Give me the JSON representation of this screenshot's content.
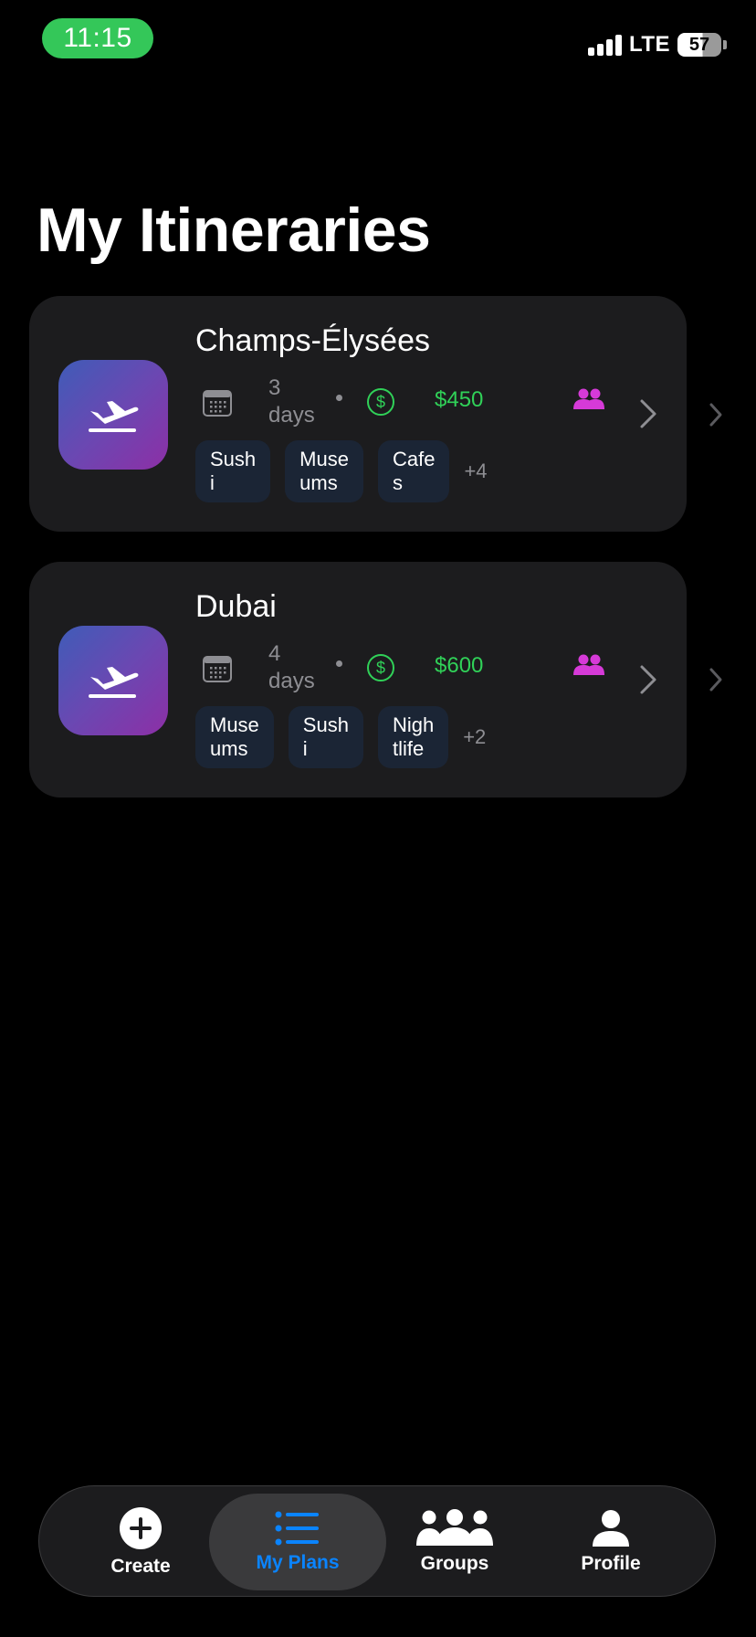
{
  "status_bar": {
    "time": "11:15",
    "network": "LTE",
    "battery": "57"
  },
  "header": {
    "title": "My Itineraries"
  },
  "itineraries": [
    {
      "title": "Champs-Élysées",
      "days_number": "3",
      "days_unit": "days",
      "price": "$450",
      "currency_symbol": "$",
      "tags": [
        {
          "line1": "Sush",
          "line2": "i"
        },
        {
          "line1": "Muse",
          "line2": "ums"
        },
        {
          "line1": "Cafe",
          "line2": "s"
        }
      ],
      "more": "+4"
    },
    {
      "title": "Dubai",
      "days_number": "4",
      "days_unit": "days",
      "price": "$600",
      "currency_symbol": "$",
      "tags": [
        {
          "line1": "Muse",
          "line2": "ums"
        },
        {
          "line1": "Sush",
          "line2": "i"
        },
        {
          "line1": "Nigh",
          "line2": "tlife"
        }
      ],
      "more": "+2"
    }
  ],
  "tab_bar": {
    "items": [
      {
        "label": "Create",
        "icon": "plus-circle-icon"
      },
      {
        "label": "My Plans",
        "icon": "list-icon",
        "selected": true
      },
      {
        "label": "Groups",
        "icon": "groups-icon"
      },
      {
        "label": "Profile",
        "icon": "person-icon"
      }
    ]
  },
  "colors": {
    "background": "#000000",
    "card": "#1c1c1e",
    "accent_blue": "#0a84ff",
    "price_green": "#30d158",
    "status_green": "#34c759",
    "group_magenta": "#d63ad8",
    "tag_bg": "#1b2535"
  }
}
